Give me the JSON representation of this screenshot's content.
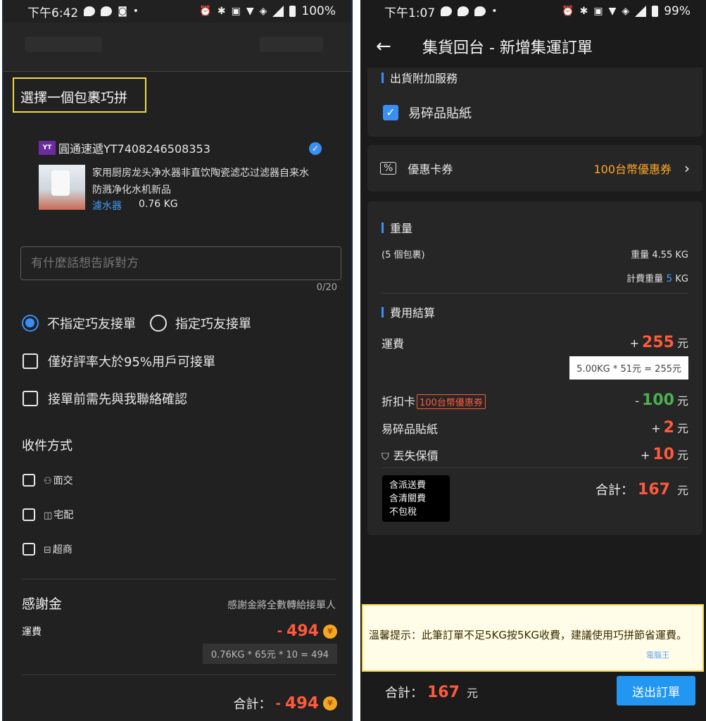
{
  "left": {
    "status": {
      "time": "下午6:42",
      "battery": "100%"
    },
    "section_title": "選擇一個包裹巧拼",
    "package": {
      "carrier_logo": "YT",
      "carrier": "圓通速遞YT7408246508353",
      "description": "家用厨房龙头净水器非直饮陶瓷滤芯过滤器自来水防溅净化水机新品",
      "category": "濾水器",
      "weight": "0.76 KG"
    },
    "message": {
      "placeholder": "有什麼話想告訴對方",
      "counter": "0/20"
    },
    "radios": [
      {
        "label": "不指定巧友接單",
        "checked": true
      },
      {
        "label": "指定巧友接單",
        "checked": false
      }
    ],
    "options": [
      "僅好評率大於95%用戶可接單",
      "接單前需先與我聯絡確認"
    ],
    "delivery": {
      "title": "收件方式",
      "items": [
        {
          "label": "面交",
          "icon": "people-icon"
        },
        {
          "label": "宅配",
          "icon": "box-icon"
        },
        {
          "label": "超商",
          "icon": "store-icon"
        }
      ]
    },
    "thanks": {
      "title": "感謝金",
      "note": "感謝金將全數轉給接單人",
      "fee_label": "運費",
      "fee_sign": "-",
      "fee_amount": "494",
      "formula": "0.76KG * 65元 * 10 = 494",
      "total_label": "合計：",
      "total_sign": "-",
      "total_amount": "494"
    }
  },
  "right": {
    "status": {
      "time": "下午1:07",
      "battery": "99%"
    },
    "title": "集貨回台 - 新增集運訂單",
    "extra_service": {
      "title": "出貨附加服務",
      "fragile": "易碎品貼紙",
      "checked": true
    },
    "coupon": {
      "label": "優惠卡券",
      "value": "100台幣優惠券"
    },
    "weight": {
      "title": "重量",
      "packages": "(5 個包裹)",
      "weight_label": "重量",
      "weight_value": "4.55 KG",
      "billable_label": "計費重量",
      "billable_value": "5",
      "billable_unit": "KG"
    },
    "fees": {
      "title": "費用結算",
      "shipping_label": "運費",
      "shipping_sign": "+",
      "shipping_value": "255",
      "shipping_formula": "5.00KG * 51元 = 255元",
      "discount_label": "折扣卡",
      "discount_tag": "100台幣優惠券",
      "discount_sign": "-",
      "discount_value": "100",
      "fragile_label": "易碎品貼紙",
      "fragile_sign": "+",
      "fragile_value": "2",
      "insurance_label": "丟失保價",
      "insurance_sign": "+",
      "insurance_value": "10",
      "unit": "元",
      "included": [
        "含派送費",
        "含清關費",
        "不包稅"
      ],
      "total_label": "合計：",
      "total_value": "167"
    },
    "tip": "溫馨提示：此筆訂單不足5KG按5KG收費，建議使用巧拼節省運費。",
    "bottom": {
      "total_label": "合計：",
      "total_value": "167",
      "unit": "元",
      "submit": "送出訂單"
    },
    "watermark": "電腦王"
  },
  "colors": {
    "accent": "#3a8ff5",
    "price": "#ff5a3d",
    "discount": "#4caf50",
    "coupon": "#ffa726",
    "highlight": "#f3d84b"
  }
}
